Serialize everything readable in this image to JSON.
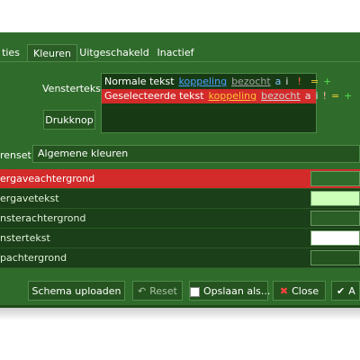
{
  "tabs": [
    {
      "label": "ties",
      "active": false
    },
    {
      "label": "Kleuren",
      "active": true
    },
    {
      "label": "Uitgeschakeld",
      "active": false
    },
    {
      "label": "Inactief",
      "active": false
    }
  ],
  "window_label": "Venstertekst",
  "preview": {
    "normal": {
      "text": "Normale tekst",
      "link": "koppeling",
      "visited": "bezocht",
      "a": "a",
      "i": "i",
      "bang": "!",
      "eq": "=",
      "plus": "+"
    },
    "selected": {
      "text": "Geselecteerde tekst",
      "link": "koppeling",
      "visited": "bezocht",
      "a": "a",
      "i": "i",
      "bang": "!",
      "eq": "=",
      "plus": "+"
    }
  },
  "push_button_label": "Drukknop",
  "colorset": {
    "label": "renset:",
    "value": "Algemene kleuren"
  },
  "color_items": [
    {
      "label": "ergaveachtergrond",
      "swatch": "#2f6b2b",
      "selected": true
    },
    {
      "label": "ergavetekst",
      "swatch": "#ccffb8",
      "selected": false
    },
    {
      "label": "nsterachtergrond",
      "swatch": "#2b5e27",
      "selected": false
    },
    {
      "label": "nstertekst",
      "swatch": "#ffffff",
      "selected": false
    },
    {
      "label": "pachtergrond",
      "swatch": "#24531f",
      "selected": false
    }
  ],
  "buttons": {
    "upload": "Schema uploaden",
    "reset": "Reset",
    "save_as": "Opslaan als...",
    "close": "Close",
    "apply": "A"
  },
  "colors": {
    "window_bg": "#2f6b2b",
    "selection": "#d32a2a",
    "border": "#4f8a48"
  }
}
